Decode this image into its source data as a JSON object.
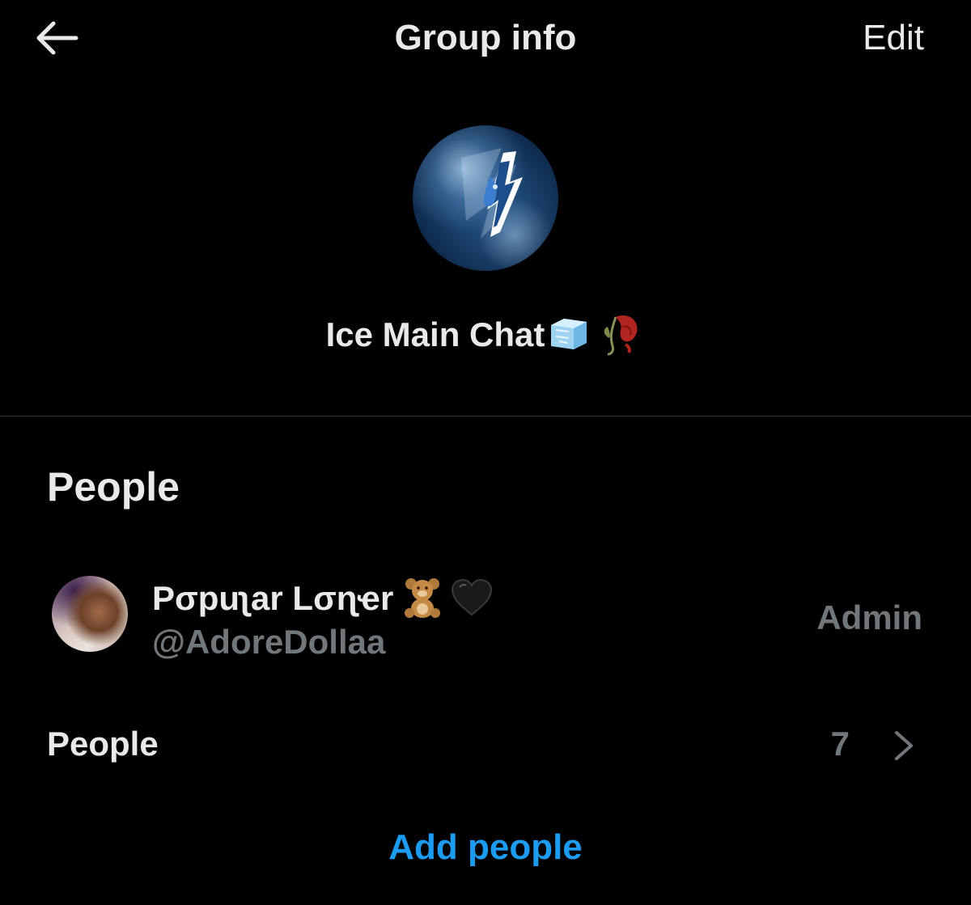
{
  "header": {
    "title": "Group info",
    "edit_label": "Edit",
    "back_icon": "arrow-left-icon"
  },
  "group": {
    "name": "Ice Main Chat",
    "name_emojis": [
      "ice-cube",
      "wilted-rose"
    ]
  },
  "people_section": {
    "title": "People",
    "members": [
      {
        "display_name": "Pσpuʅar Lσɳҽr",
        "name_emojis": [
          "teddy-bear",
          "black-heart"
        ],
        "handle": "@AdoreDollaa",
        "role": "Admin"
      }
    ],
    "people_row": {
      "label": "People",
      "count": "7"
    },
    "add_people_label": "Add people"
  },
  "colors": {
    "background": "#000000",
    "primary_text": "#e7e9ea",
    "secondary_text": "#71767b",
    "accent": "#1d9bf0",
    "divider": "#2f3336"
  }
}
